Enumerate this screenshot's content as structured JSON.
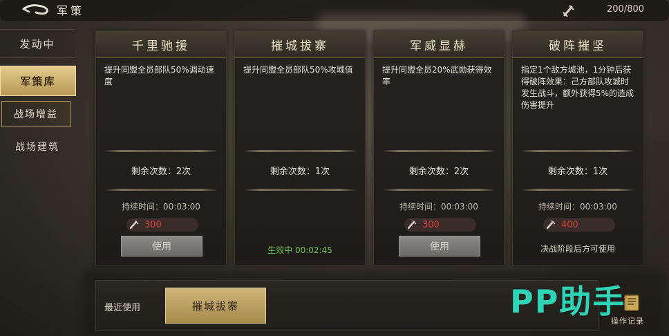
{
  "header": {
    "title": "军策",
    "resource_count": "200/800",
    "resource_icon": "scroll-quill-icon"
  },
  "sidebar": {
    "items": [
      {
        "label": "发动中"
      },
      {
        "label": "军策库"
      },
      {
        "label": "战场增益"
      },
      {
        "label": "战场建筑"
      }
    ]
  },
  "cards": [
    {
      "title": "千里驰援",
      "desc": "提升同盟全员部队50%调动速度",
      "remain": "剩余次数：2次",
      "duration": "持续时间：00:03:00",
      "cost": "300",
      "button": "使用"
    },
    {
      "title": "摧城拔寨",
      "desc": "提升同盟全员部队50%攻城值",
      "remain": "剩余次数：1次",
      "duration": "",
      "cost": "",
      "active": "生效中 00:02:45"
    },
    {
      "title": "军威显赫",
      "desc": "提升同盟全员20%武勋获得效率",
      "remain": "剩余次数：2次",
      "duration": "持续时间：00:03:00",
      "cost": "300",
      "button": "使用"
    },
    {
      "title": "破阵摧坚",
      "desc": "指定1个敌方城池，1分钟后获得破阵效果：己方部队攻城时发生战斗，额外获得5%的造成伤害提升",
      "remain": "剩余次数：1次",
      "duration": "持续时间：00:03:00",
      "cost": "400",
      "note": "决战阶段后方可使用"
    }
  ],
  "recent": {
    "label": "最近使用",
    "item": "摧城拔寨"
  },
  "log": {
    "label": "操作记录"
  },
  "watermark": "PP助手",
  "colors": {
    "accent_gold": "#cfb57a",
    "cost_red": "#e0443c",
    "active_green": "#6cc24a",
    "watermark_teal": "#2fd3b6"
  }
}
